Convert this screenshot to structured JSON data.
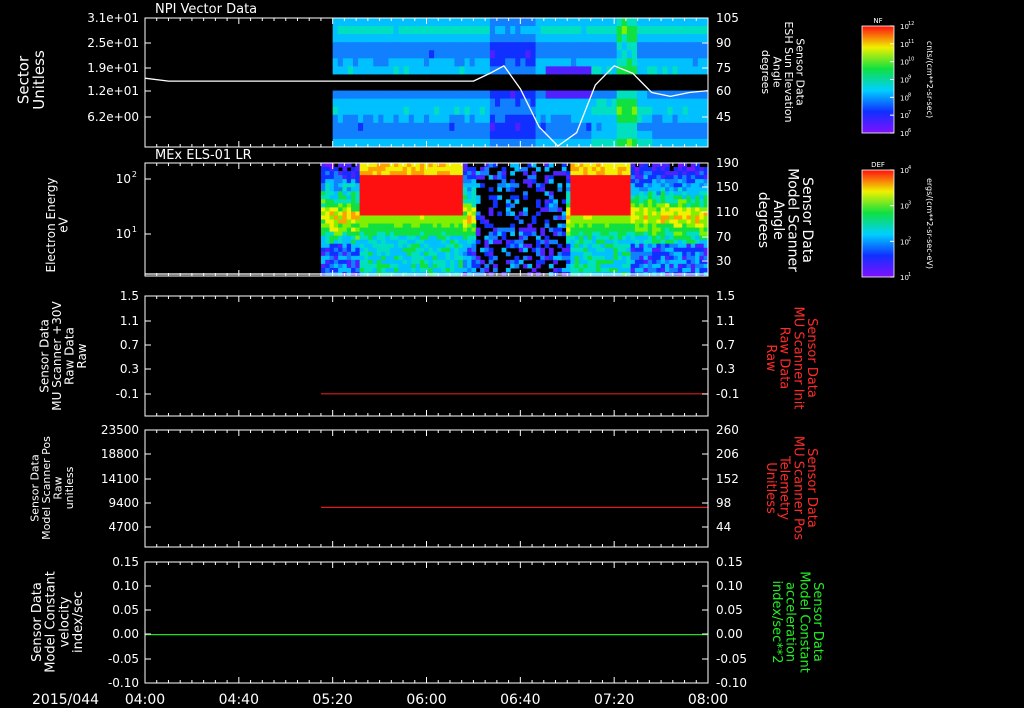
{
  "time_axis": {
    "date_label": "2015/044",
    "ticks": [
      "04:00",
      "04:40",
      "05:20",
      "06:00",
      "06:40",
      "07:20",
      "08:00"
    ]
  },
  "colors": {
    "background": "#000000",
    "axis": "#ffffff",
    "red_trace": "#dd1c1c",
    "green_trace": "#22dd22",
    "red_label": "#ff2a2a",
    "green_label": "#22ee22"
  },
  "chart_data": [
    {
      "type": "heatmap",
      "title": "NPI Vector Data",
      "left_axis_label": [
        "Sector",
        "Unitless"
      ],
      "left_ticks": [
        "3.1e+01",
        "2.5e+01",
        "1.9e+01",
        "1.2e+01",
        "6.2e+00"
      ],
      "right_axis_label": [
        "Sensor Data",
        "ESH Sun Elevation",
        "Angle",
        "degrees"
      ],
      "right_ticks": [
        "105",
        "90",
        "75",
        "60",
        "45"
      ],
      "data_start": "05:20",
      "overlay_line": {
        "name": "ESH Sun Elevation Angle",
        "units": "degrees",
        "points": [
          [
            "04:00",
            73.5
          ],
          [
            "04:10",
            72
          ],
          [
            "05:20",
            72
          ],
          [
            "06:20",
            72
          ],
          [
            "06:27",
            76
          ],
          [
            "06:33",
            80
          ],
          [
            "06:40",
            68
          ],
          [
            "06:48",
            48
          ],
          [
            "06:56",
            38
          ],
          [
            "07:04",
            45
          ],
          [
            "07:12",
            70
          ],
          [
            "07:20",
            80
          ],
          [
            "07:28",
            76
          ],
          [
            "07:36",
            66
          ],
          [
            "07:44",
            64
          ],
          [
            "07:52",
            66
          ],
          [
            "08:00",
            67
          ]
        ]
      },
      "colorbar": {
        "label": "NF",
        "units": "cnts/(cm**2-sr-sec)",
        "ticks": [
          "10^12",
          "10^11",
          "10^10",
          "10^9",
          "10^8",
          "10^7",
          "10^6"
        ]
      }
    },
    {
      "type": "heatmap",
      "title": "MEx ELS-01 LR",
      "left_axis_label": [
        "Electron Energy",
        "eV"
      ],
      "left_ticks": [
        "10^2",
        "10^1"
      ],
      "right_axis_label": [
        "Sensor Data",
        "Model Scanner",
        "Angle",
        "degrees"
      ],
      "right_ticks": [
        "190",
        "150",
        "110",
        "70",
        "30"
      ],
      "data_start": "05:15",
      "bursts": [
        {
          "start": "05:30",
          "end": "06:14"
        },
        {
          "start": "07:00",
          "end": "07:26"
        }
      ],
      "overlay_line": {
        "name": "Model Scanner Angle",
        "units": "degrees",
        "points": [
          [
            "04:00",
            1
          ],
          [
            "08:00",
            1
          ]
        ]
      },
      "colorbar": {
        "label": "DEF",
        "units": "ergs/(cm**2-sr-sec-eV)",
        "ticks": [
          "10^4",
          "10^3",
          "10^2",
          "10^1"
        ]
      }
    },
    {
      "type": "line",
      "left_axis_label": [
        "Sensor Data",
        "MU Scanner +30V",
        "Raw Data",
        "Raw"
      ],
      "left_ticks": [
        "1.5",
        "1.1",
        "0.7",
        "0.3",
        "-0.1"
      ],
      "right_axis_label": [
        "Sensor Data",
        "MU Scanner Init",
        "Raw Data",
        "Raw"
      ],
      "right_ticks": [
        "1.5",
        "1.1",
        "0.7",
        "0.3",
        "-0.1"
      ],
      "ylim": [
        -0.34,
        1.5
      ],
      "series": [
        {
          "name": "MU Scanner Init Raw Data",
          "start": "05:15",
          "end": "08:00",
          "value": 0.0
        }
      ]
    },
    {
      "type": "line",
      "left_axis_label": [
        "Sensor Data",
        "Model Scanner Pos",
        "Raw",
        "unitless"
      ],
      "left_ticks": [
        "23500",
        "18800",
        "14100",
        "9400",
        "4700"
      ],
      "right_axis_label": [
        "Sensor Data",
        "MU Scanner Pos",
        "Telemetry",
        "Unitless"
      ],
      "right_ticks": [
        "260",
        "206",
        "152",
        "98",
        "44"
      ],
      "ylim_right": [
        0,
        260
      ],
      "series": [
        {
          "name": "MU Scanner Pos Telemetry",
          "start": "05:15",
          "end": "08:00",
          "value": 88
        }
      ]
    },
    {
      "type": "line",
      "left_axis_label": [
        "Sensor Data",
        "Model Constant",
        "velocity",
        "index/sec"
      ],
      "left_ticks": [
        "0.15",
        "0.10",
        "0.05",
        "0.00",
        "-0.05",
        "-0.10"
      ],
      "right_axis_label": [
        "Sensor Data",
        "Model Constant",
        "acceleration",
        "index/sec**2"
      ],
      "right_ticks": [
        "0.15",
        "0.10",
        "0.05",
        "0.00",
        "-0.05",
        "-0.10"
      ],
      "ylim": [
        -0.1,
        0.15
      ],
      "series": [
        {
          "name": "Model Constant acceleration",
          "start": "04:00",
          "end": "08:00",
          "value": 0.0
        }
      ]
    }
  ]
}
